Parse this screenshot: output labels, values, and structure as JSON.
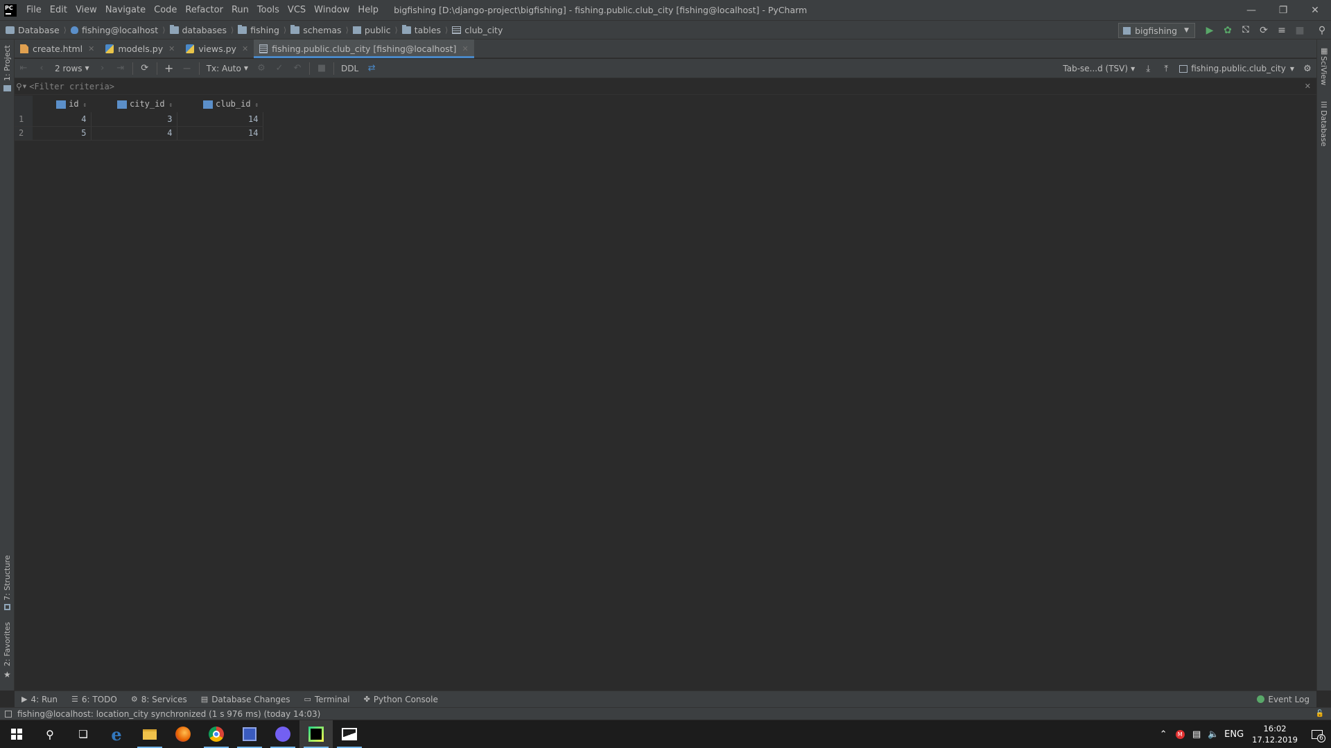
{
  "titlebar": {
    "app_logo": "PC",
    "menu": [
      "File",
      "Edit",
      "View",
      "Navigate",
      "Code",
      "Refactor",
      "Run",
      "Tools",
      "VCS",
      "Window",
      "Help"
    ],
    "title": "bigfishing [D:\\django-project\\bigfishing] - fishing.public.club_city [fishing@localhost] - PyCharm"
  },
  "breadcrumbs": [
    "Database",
    "fishing@localhost",
    "databases",
    "fishing",
    "schemas",
    "public",
    "tables",
    "club_city"
  ],
  "run_config": "bigfishing",
  "tabs": [
    {
      "label": "create.html",
      "active": false
    },
    {
      "label": "models.py",
      "active": false
    },
    {
      "label": "views.py",
      "active": false
    },
    {
      "label": "fishing.public.club_city [fishing@localhost]",
      "active": true
    }
  ],
  "toolbar": {
    "rows_label": "2 rows",
    "tx_label": "Tx: Auto",
    "ddl_label": "DDL",
    "export_format": "Tab-se...d (TSV)",
    "table_selector": "fishing.public.club_city"
  },
  "filter": {
    "placeholder": "<Filter criteria>"
  },
  "grid": {
    "columns": [
      "id",
      "city_id",
      "club_id"
    ],
    "rows": [
      {
        "num": "1",
        "cells": [
          "4",
          "3",
          "14"
        ]
      },
      {
        "num": "2",
        "cells": [
          "5",
          "4",
          "14"
        ]
      }
    ]
  },
  "side_panels": {
    "left_top": "1: Project",
    "left_mid": "7: Structure",
    "left_bottom": "2: Favorites",
    "right_top": "SciView",
    "right_mid": "Database"
  },
  "bottom_tools": [
    "4: Run",
    "6: TODO",
    "8: Services",
    "Database Changes",
    "Terminal",
    "Python Console"
  ],
  "event_log": "Event Log",
  "status_text": "fishing@localhost: location_city synchronized (1 s 976 ms) (today 14:03)",
  "taskbar": {
    "language": "ENG",
    "time": "16:02",
    "date": "17.12.2019",
    "notifications": "6"
  },
  "colors": {
    "accent": "#4a88c7",
    "bg": "#2b2b2b",
    "panel": "#3c3f41"
  }
}
